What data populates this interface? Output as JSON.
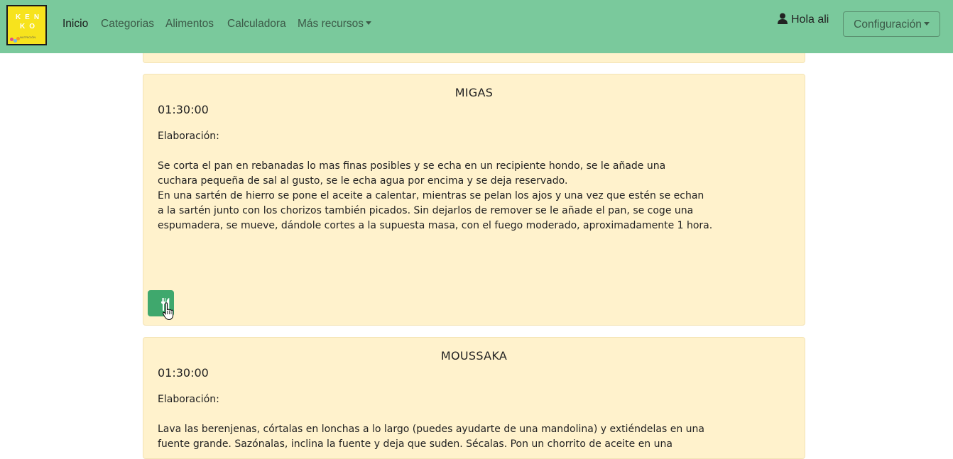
{
  "navbar": {
    "logo_line1": "KEN",
    "logo_line2": "KO",
    "logo_line3": "NUTRICIÓN",
    "links": [
      "Inicio",
      "Categorias",
      "Alimentos",
      "Calculadora",
      "Más recursos"
    ],
    "user_greeting": "Hola ali",
    "config_label": "Configuración",
    "bg_color": "#7ac99c"
  },
  "recipes": [
    {
      "title": "MIGAS",
      "time": "01:30:00",
      "label": "Elaboración:",
      "lines": [
        "Se corta el pan en rebanadas lo mas finas posibles y se echa en un recipiente hondo, se le añade una",
        "cuchara pequeña de sal al gusto, se le echa agua por encima y se deja reservado.",
        "En una sartén de hierro se pone el aceite a calentar, mientras se pelan los ajos y una vez que estén se echan",
        "a la sartén junto con los chorizos también picados. Sin dejarlos de remover se le añade el pan, se coge una",
        "espumadera, se mueve, dándole cortes a la supuesta masa, con el fuego moderado, aproximadamente 1 hora."
      ],
      "button_icon": "utensils-icon"
    },
    {
      "title": "MOUSSAKA",
      "time": "01:30:00",
      "label": "Elaboración:",
      "lines": [
        "Lava las berenjenas, córtalas en lonchas a lo largo (puedes ayudarte de una mandolina) y extiéndelas en una",
        "fuente grande. Sazónalas, inclina la fuente y deja que suden. Sécalas. Pon un chorrito de aceite en una"
      ]
    }
  ],
  "colors": {
    "card_bg": "#fff2cc",
    "button_green": "#3fa86d"
  }
}
